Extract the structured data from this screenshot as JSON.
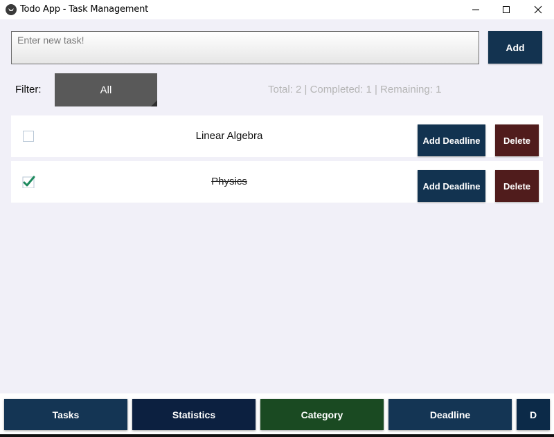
{
  "window": {
    "title": "Todo App - Task Management",
    "icon": "kivy-app-icon"
  },
  "input": {
    "placeholder": "Enter new task!",
    "value": "",
    "add_label": "Add"
  },
  "filter": {
    "label": "Filter:",
    "selected": "All"
  },
  "stats": {
    "text": "Total: 2 | Completed: 1 | Remaining: 1",
    "total": 2,
    "completed": 1,
    "remaining": 1
  },
  "tasks": [
    {
      "title": "Linear Algebra",
      "done": false,
      "deadline_label": "Add Deadline",
      "delete_label": "Delete"
    },
    {
      "title": "Physics",
      "done": true,
      "deadline_label": "Add Deadline",
      "delete_label": "Delete"
    }
  ],
  "nav": {
    "items": [
      {
        "label": "Tasks"
      },
      {
        "label": "Statistics"
      },
      {
        "label": "Category"
      },
      {
        "label": "Deadline"
      },
      {
        "label": "D"
      }
    ]
  },
  "colors": {
    "primary": "#133350",
    "delete": "#501c1c",
    "category": "#1a4a22",
    "check": "#1e8a5e",
    "background": "#f1f0f8"
  }
}
